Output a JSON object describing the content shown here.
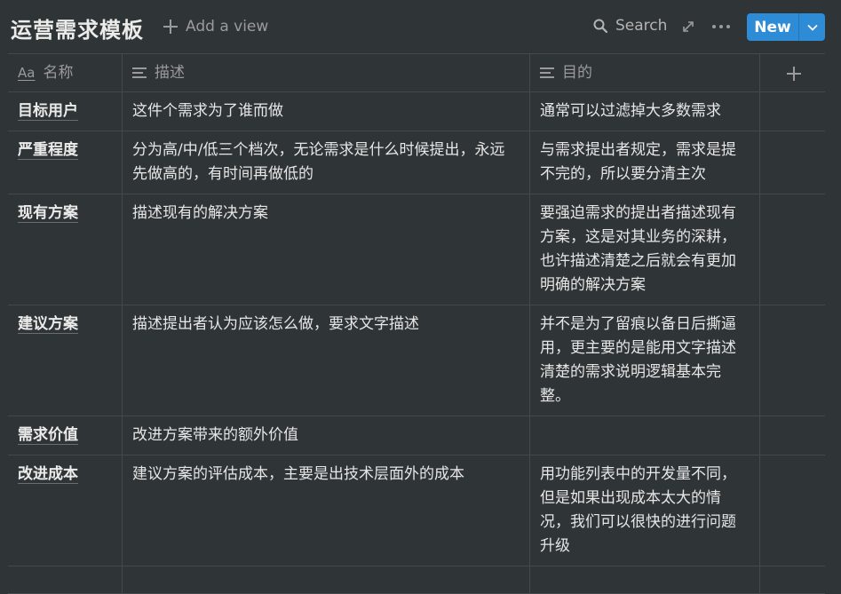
{
  "header": {
    "title": "运营需求模板",
    "add_view": "Add a view",
    "search": "Search",
    "new_button": "New"
  },
  "columns": [
    {
      "icon": "Aa",
      "label": "名称"
    },
    {
      "icon": "text-lines-icon",
      "label": "描述"
    },
    {
      "icon": "text-lines-icon",
      "label": "目的"
    }
  ],
  "rows": [
    {
      "name": "目标用户",
      "desc": "这件个需求为了谁而做",
      "purpose": "通常可以过滤掉大多数需求"
    },
    {
      "name": "严重程度",
      "desc": "分为高/中/低三个档次，无论需求是什么时候提出，永远先做高的，有时间再做低的",
      "purpose": "与需求提出者规定，需求是提不完的，所以要分清主次"
    },
    {
      "name": "现有方案",
      "desc": "描述现有的解决方案",
      "purpose": "要强迫需求的提出者描述现有方案，这是对其业务的深耕，也许描述清楚之后就会有更加明确的解决方案"
    },
    {
      "name": "建议方案",
      "desc": "描述提出者认为应该怎么做，要求文字描述",
      "purpose": "并不是为了留痕以备日后撕逼用，更主要的是能用文字描述清楚的需求说明逻辑基本完整。"
    },
    {
      "name": "需求价值",
      "desc": "改进方案带来的额外价值",
      "purpose": ""
    },
    {
      "name": "改进成本",
      "desc": "建议方案的评估成本，主要是出技术层面外的成本",
      "purpose": " 用功能列表中的开发量不同，但是如果出现成本太大的情况，我们可以很快的进行问题升级"
    }
  ],
  "colors": {
    "background": "#2f3437",
    "accent": "#2e8bd6",
    "border": "#45494c"
  }
}
